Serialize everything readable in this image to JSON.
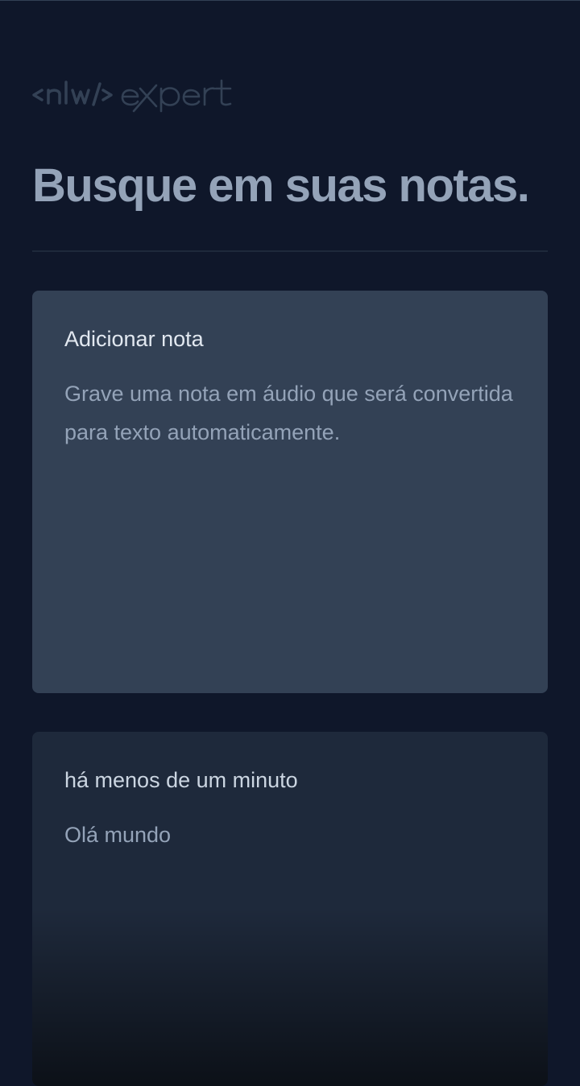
{
  "app": {
    "logo_text": "<nlw/> expert"
  },
  "search": {
    "placeholder": "Busque em suas notas."
  },
  "add_note_card": {
    "title": "Adicionar nota",
    "description": "Grave uma nota em áudio que será convertida para texto automaticamente."
  },
  "notes": [
    {
      "date": "há menos de um minuto",
      "content": "Olá mundo"
    }
  ],
  "colors": {
    "background": "#0f172a",
    "card_add": "#334155",
    "card_note": "#1e293b",
    "title_text": "#94a3b8"
  }
}
